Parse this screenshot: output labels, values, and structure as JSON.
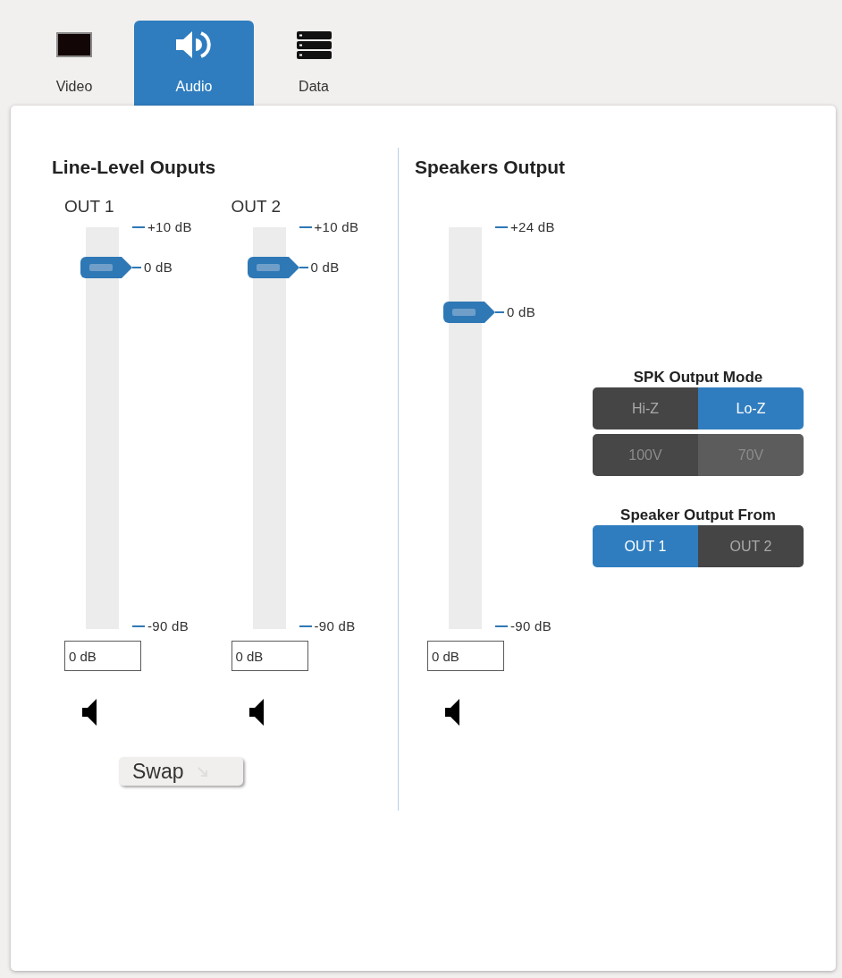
{
  "tabs": [
    {
      "label": "Video",
      "kind": "video",
      "selected": false
    },
    {
      "label": "Audio",
      "kind": "audio",
      "selected": true
    },
    {
      "label": "Data",
      "kind": "data",
      "selected": false
    }
  ],
  "line_level_outputs": {
    "title": "Line-Level Ouputs",
    "channels": [
      {
        "label": "OUT 1",
        "max_label": "+10 dB",
        "value_label": "0 dB",
        "min_label": "-90 dB",
        "level": 0.9,
        "value": "0 dB",
        "muted": false
      },
      {
        "label": "OUT 2",
        "max_label": "+10 dB",
        "value_label": "0 dB",
        "min_label": "-90 dB",
        "level": 0.9,
        "value": "0 dB",
        "muted": false
      }
    ],
    "swap_button": "Swap"
  },
  "speakers_output": {
    "title": "Speakers Output",
    "channel": {
      "max_label": "+24 dB",
      "value_label": "0 dB",
      "min_label": "-90 dB",
      "level": 0.789,
      "value": "0 dB",
      "muted": false
    },
    "mode": {
      "label": "SPK Output Mode",
      "rows": [
        {
          "disabled": false,
          "options": [
            {
              "label": "Hi-Z",
              "selected": false
            },
            {
              "label": "Lo-Z",
              "selected": true
            }
          ]
        },
        {
          "disabled": true,
          "options": [
            {
              "label": "100V",
              "selected": false
            },
            {
              "label": "70V",
              "selected": true
            }
          ]
        }
      ]
    },
    "output_from": {
      "label": "Speaker Output From",
      "options": [
        {
          "label": "OUT 1",
          "selected": true
        },
        {
          "label": "OUT 2",
          "selected": false
        }
      ]
    }
  }
}
